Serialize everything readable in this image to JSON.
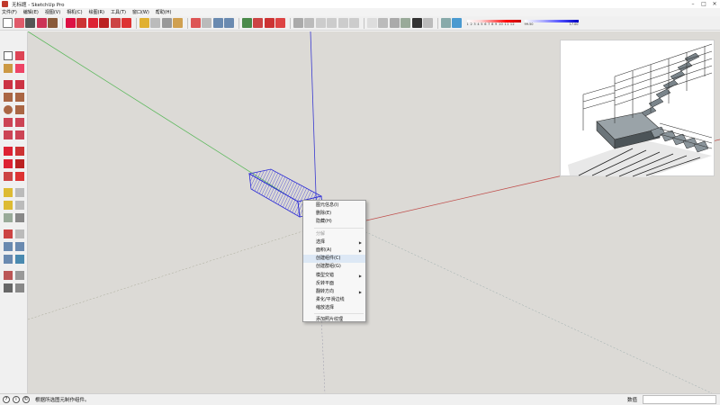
{
  "window": {
    "title": "无标题 - SketchUp Pro",
    "minimize": "–",
    "maximize": "□",
    "close": "✕"
  },
  "menubar": [
    "文件(F)",
    "编辑(E)",
    "视图(V)",
    "相机(C)",
    "绘图(R)",
    "工具(T)",
    "窗口(W)",
    "帮助(H)"
  ],
  "toolbar": {
    "color_scale_1": "1 2 3 4 5 6 7 8 9 10 11 12",
    "color_scale_2_min": "99.50",
    "color_scale_2_max": "17.00"
  },
  "context_menu": {
    "items": [
      {
        "label": "图元信息(I)",
        "state": "normal",
        "submenu": false
      },
      {
        "label": "删除(E)",
        "state": "normal",
        "submenu": false
      },
      {
        "label": "隐藏(H)",
        "state": "normal",
        "submenu": false
      },
      {
        "separator": true
      },
      {
        "label": "分解",
        "state": "disabled",
        "submenu": false
      },
      {
        "label": "选择",
        "state": "normal",
        "submenu": true
      },
      {
        "label": "面积(A)",
        "state": "normal",
        "submenu": true
      },
      {
        "label": "创建组件(C)",
        "state": "hover",
        "submenu": false
      },
      {
        "label": "创建群组(G)",
        "state": "normal",
        "submenu": false
      },
      {
        "label": "模型交错",
        "state": "normal",
        "submenu": true
      },
      {
        "label": "反转平面",
        "state": "normal",
        "submenu": false
      },
      {
        "label": "翻转方向",
        "state": "normal",
        "submenu": true
      },
      {
        "label": "柔化/平滑边线",
        "state": "normal",
        "submenu": false
      },
      {
        "label": "缩放选择",
        "state": "normal",
        "submenu": false
      },
      {
        "separator": true
      },
      {
        "label": "添加照片纹理",
        "state": "normal",
        "submenu": false
      }
    ]
  },
  "statusbar": {
    "message": "根据所选图元制作组件。",
    "measurements_label": "数值",
    "measurements_value": "",
    "icons": [
      "?",
      "i",
      "©"
    ]
  },
  "colors": {
    "axis_red": "#c0504d",
    "axis_green": "#5cb85c",
    "axis_blue": "#3a3ad0",
    "selection": "#2b2bd6",
    "viewport_bg": "#dcdad6"
  }
}
